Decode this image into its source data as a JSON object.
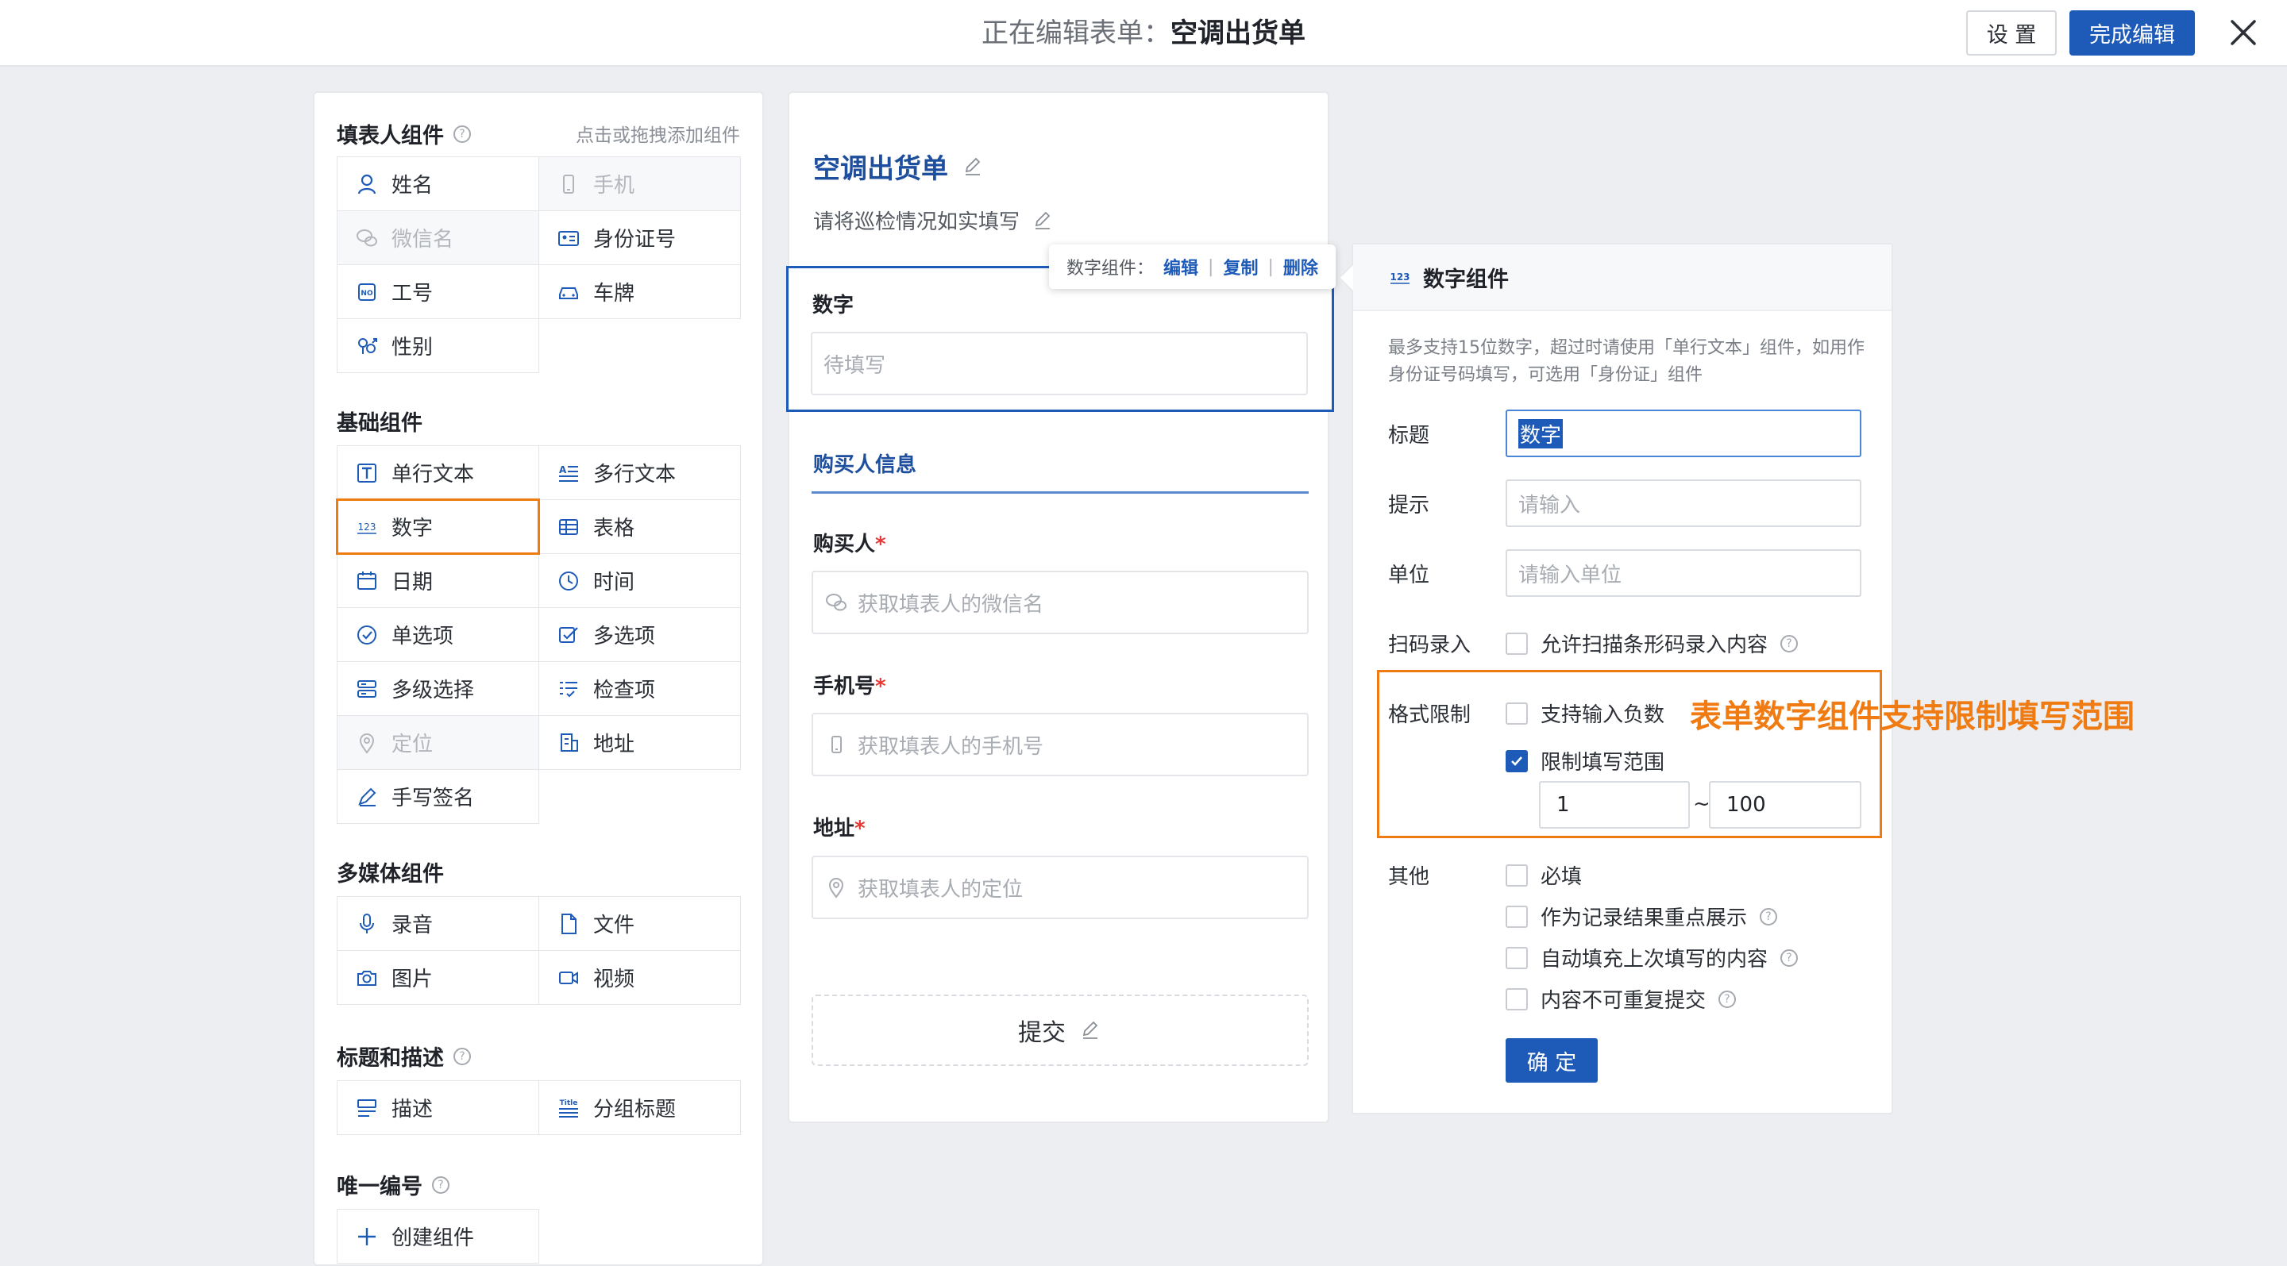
{
  "header": {
    "prefix": "正在编辑表单：",
    "form_name": "空调出货单",
    "settings_label": "设 置",
    "finish_label": "完成编辑"
  },
  "palette": {
    "filler_section": {
      "title": "填表人组件",
      "hint": "点击或拖拽添加组件",
      "items": [
        {
          "label": "姓名",
          "icon": "person-icon"
        },
        {
          "label": "手机",
          "icon": "phone-icon",
          "disabled": true
        },
        {
          "label": "微信名",
          "icon": "wechat-icon",
          "disabled": true
        },
        {
          "label": "身份证号",
          "icon": "id-card-icon"
        },
        {
          "label": "工号",
          "icon": "badge-icon"
        },
        {
          "label": "车牌",
          "icon": "car-icon"
        },
        {
          "label": "性别",
          "icon": "gender-icon"
        }
      ]
    },
    "basic_section": {
      "title": "基础组件",
      "items": [
        {
          "label": "单行文本",
          "icon": "text-icon"
        },
        {
          "label": "多行文本",
          "icon": "multiline-text-icon"
        },
        {
          "label": "数字",
          "icon": "number-icon",
          "selected": true
        },
        {
          "label": "表格",
          "icon": "table-icon"
        },
        {
          "label": "日期",
          "icon": "calendar-icon"
        },
        {
          "label": "时间",
          "icon": "clock-icon"
        },
        {
          "label": "单选项",
          "icon": "radio-icon"
        },
        {
          "label": "多选项",
          "icon": "checkbox-icon"
        },
        {
          "label": "多级选择",
          "icon": "cascade-icon"
        },
        {
          "label": "检查项",
          "icon": "checklist-icon"
        },
        {
          "label": "定位",
          "icon": "location-icon",
          "disabled": true
        },
        {
          "label": "地址",
          "icon": "building-icon"
        },
        {
          "label": "手写签名",
          "icon": "pen-icon"
        }
      ]
    },
    "media_section": {
      "title": "多媒体组件",
      "items": [
        {
          "label": "录音",
          "icon": "mic-icon"
        },
        {
          "label": "文件",
          "icon": "file-icon"
        },
        {
          "label": "图片",
          "icon": "camera-icon"
        },
        {
          "label": "视频",
          "icon": "video-icon"
        }
      ]
    },
    "title_section": {
      "title": "标题和描述",
      "items": [
        {
          "label": "描述",
          "icon": "description-icon"
        },
        {
          "label": "分组标题",
          "icon": "group-title-icon"
        }
      ]
    },
    "unique_section": {
      "title": "唯一编号",
      "items": [
        {
          "label": "创建组件",
          "icon": "plus-icon"
        }
      ]
    }
  },
  "form": {
    "title": "空调出货单",
    "description": "请将巡检情况如实填写",
    "toolbar": {
      "label": "数字组件：",
      "edit": "编辑",
      "sep": "|",
      "copy": "复制",
      "delete": "删除"
    },
    "number_field": {
      "label": "数字",
      "placeholder": "待填写"
    },
    "group_title": "购买人信息",
    "buyer_field": {
      "label": "购买人",
      "required": "*",
      "placeholder": "获取填表人的微信名"
    },
    "phone_field": {
      "label": "手机号",
      "required": "*",
      "placeholder": "获取填表人的手机号"
    },
    "address_field": {
      "label": "地址",
      "required": "*",
      "placeholder": "获取填表人的定位"
    },
    "submit_label": "提交"
  },
  "props": {
    "header": "数字组件",
    "note": "最多支持15位数字，超过时请使用「单行文本」组件，如用作身份证号码填写，可选用「身份证」组件",
    "title_label": "标题",
    "title_value": "数字",
    "hint_label": "提示",
    "hint_placeholder": "请输入",
    "unit_label": "单位",
    "unit_placeholder": "请输入单位",
    "scan_label": "扫码录入",
    "scan_option": "允许扫描条形码录入内容",
    "format_label": "格式限制",
    "negative_option": "支持输入负数",
    "range_option": "限制填写范围",
    "range_min": "1",
    "range_sep": "~",
    "range_max": "100",
    "other_label": "其他",
    "required_option": "必填",
    "highlight_option": "作为记录结果重点展示",
    "autofill_option": "自动填充上次填写的内容",
    "unique_option": "内容不可重复提交",
    "ok_label": "确 定",
    "callout": "表单数字组件支持限制填写范围"
  },
  "colors": {
    "accent": "#1e5bb8",
    "highlight": "#ef7b12",
    "required": "#e53935"
  }
}
